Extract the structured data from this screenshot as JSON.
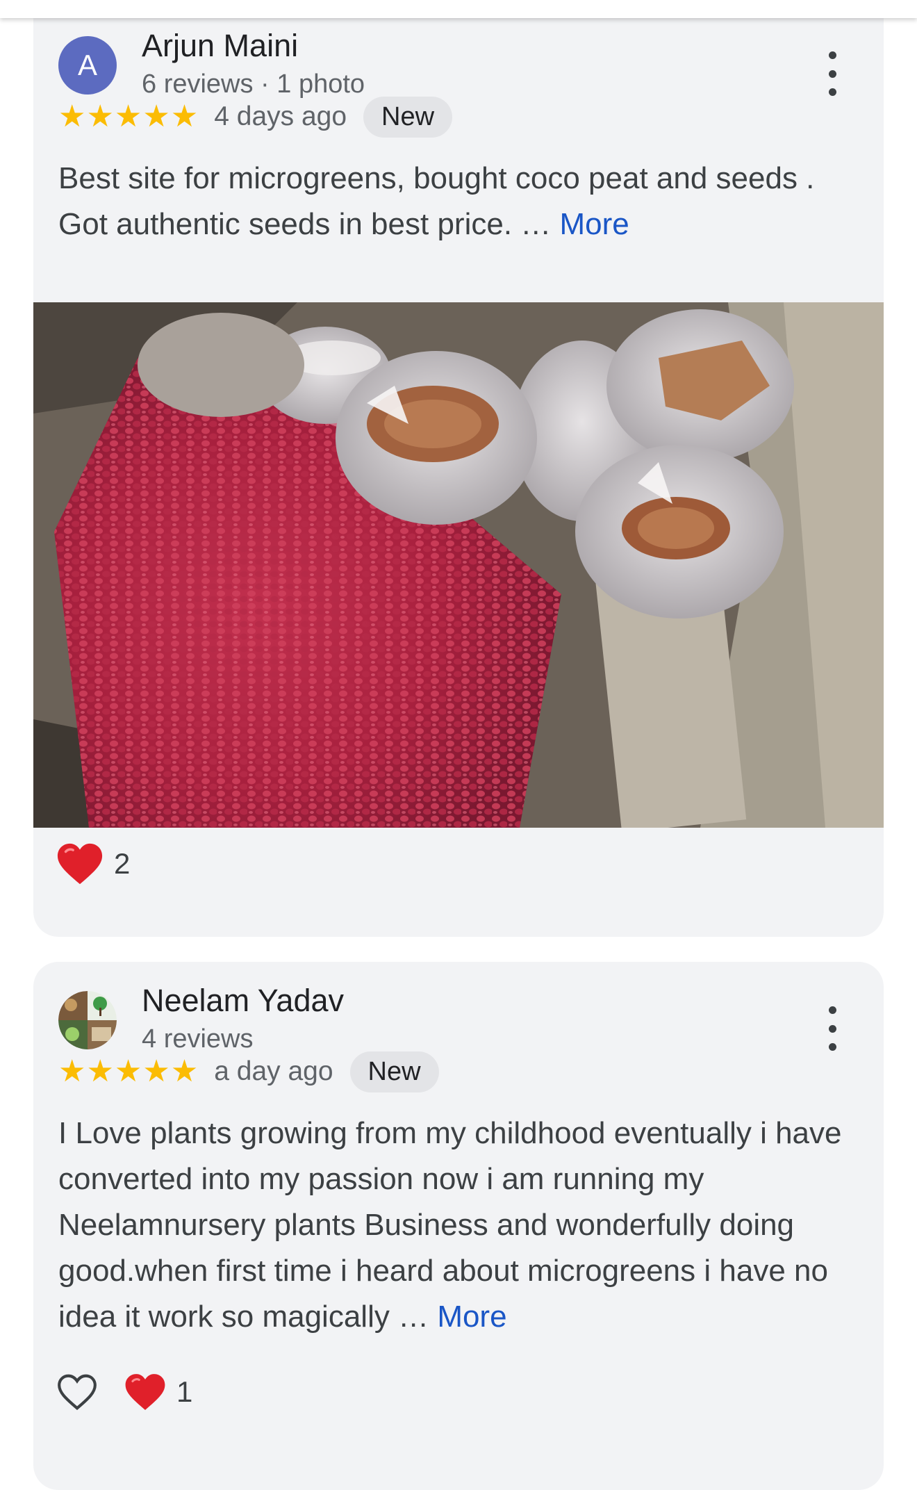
{
  "reviews": [
    {
      "avatar_letter": "A",
      "avatar_color": "#5c6bc0",
      "name": "Arjun Maini",
      "meta": "6 reviews · 1 photo",
      "stars": "★★★★★",
      "when": "4 days ago",
      "badge": "New",
      "text": "Best site for microgreens, bought coco peat and seeds . Got authentic seeds in best price. …",
      "more": "More",
      "reaction_count": "2",
      "photo_icon": "review-photo"
    },
    {
      "avatar_icon": "nursery-collage-avatar",
      "name": "Neelam Yadav",
      "meta": "4 reviews",
      "stars": "★★★★★",
      "when": "a day ago",
      "badge": "New",
      "text": "I Love plants growing from my childhood eventually i have converted into my passion now i am running my Neelamnursery plants Business and wonderfully doing good.when first time i heard about microgreens i have no idea it work so magically …",
      "more": "More",
      "reaction_count": "1"
    }
  ],
  "colors": {
    "card_bg": "#f2f3f5",
    "star": "#fbbc04",
    "link": "#1a56c6",
    "heart": "#e0202a"
  }
}
